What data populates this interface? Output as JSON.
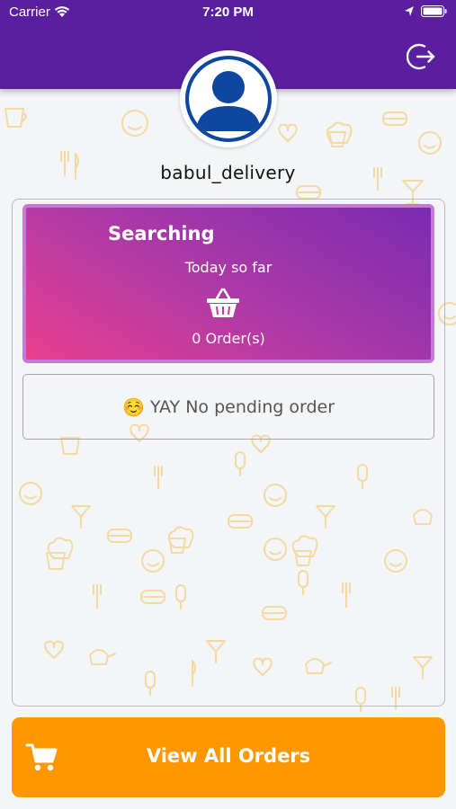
{
  "status_bar": {
    "carrier": "Carrier",
    "time": "7:20 PM"
  },
  "header": {
    "logout_icon": "logout-icon",
    "color": "#5a1fa0"
  },
  "profile": {
    "avatar_icon": "user-avatar-icon",
    "username": "babul_delivery"
  },
  "stats": {
    "status": "Searching",
    "period_label": "Today so far",
    "icon": "basket-icon",
    "orders_count": "0 Order(s)"
  },
  "pending": {
    "emoji": "☺️",
    "message": "YAY No pending order"
  },
  "footer": {
    "cart_icon": "cart-icon",
    "button_label": "View All Orders",
    "accent": "#ff9800"
  }
}
